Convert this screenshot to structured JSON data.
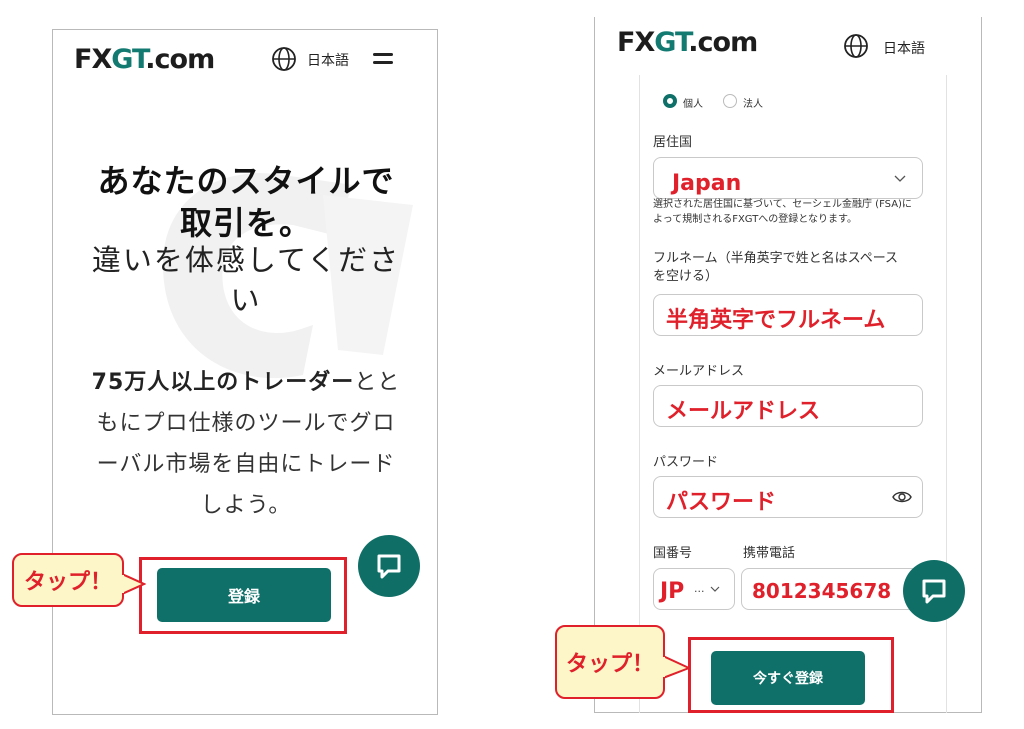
{
  "left": {
    "logo": {
      "fx": "FX",
      "g": "G",
      "t": "T",
      "com": ".com"
    },
    "lang_label": "日本語",
    "headline_bold_1": "あなたのスタイルで",
    "headline_bold_2": "取引を。",
    "headline_sub_1": "違いを体感してくださ",
    "headline_sub_2": "い",
    "body_bold": "75万人以上のトレーダー",
    "body_1": "とと",
    "body_2": "もにプロ仕様のツールでグロ",
    "body_3": "ーバル市場を自由にトレード",
    "body_4": "しよう。",
    "register_label": "登録",
    "callout_label": "タップ！"
  },
  "right": {
    "logo": {
      "fx": "FX",
      "g": "G",
      "t": "T",
      "com": ".com"
    },
    "lang_label": "日本語",
    "radio_individual": "個人",
    "radio_corporate": "法人",
    "country_label": "居住国",
    "country_value": "Japan",
    "country_note_1": "選択された居住国に基づいて、セーシェル金融庁 (FSA)に",
    "country_note_2": "よって規制されるFXGTへの登録となります。",
    "fullname_label_1": "フルネーム（半角英字で姓と名はスペース",
    "fullname_label_2": "を空ける）",
    "fullname_value": "半角英字でフルネーム",
    "email_label": "メールアドレス",
    "email_value": "メールアドレス",
    "password_label": "パスワード",
    "password_value": "パスワード",
    "country_code_label": "国番号",
    "phone_label": "携帯電話",
    "country_code_value": "JP",
    "country_code_suffix": "...",
    "phone_value": "8012345678",
    "register_label": "今すぐ登録",
    "callout_label": "タップ！"
  },
  "colors": {
    "brand": "#0f7069",
    "highlight": "#e0202a",
    "callout_bg": "#fdf6c8"
  }
}
